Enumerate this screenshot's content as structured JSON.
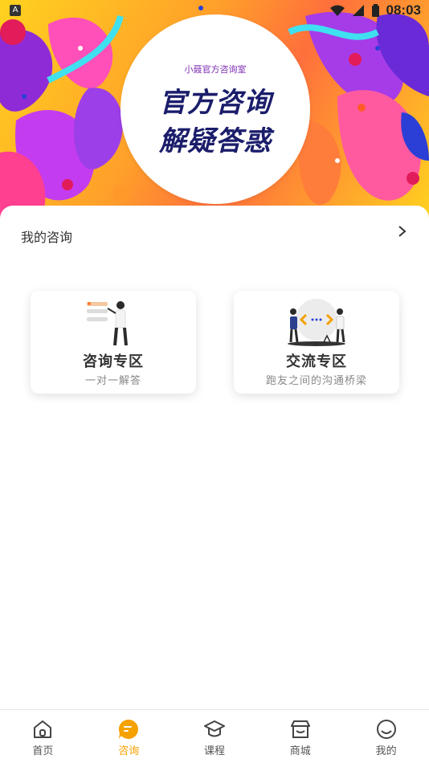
{
  "status_bar": {
    "time": "08:03",
    "indicator": "A"
  },
  "banner": {
    "room_name": "小聂官方咨询室",
    "slogan_line1": "官方咨询",
    "slogan_line2": "解疑答惑"
  },
  "my_consult": {
    "label": "我的咨询"
  },
  "cards": [
    {
      "title": "咨询专区",
      "subtitle": "一对一解答"
    },
    {
      "title": "交流专区",
      "subtitle": "跑友之间的沟通桥梁"
    }
  ],
  "nav": {
    "active_color": "#f5a100",
    "items": [
      {
        "label": "首页",
        "icon": "home-icon"
      },
      {
        "label": "咨询",
        "icon": "chat-icon"
      },
      {
        "label": "课程",
        "icon": "graduation-cap-icon"
      },
      {
        "label": "商城",
        "icon": "store-icon"
      },
      {
        "label": "我的",
        "icon": "smile-icon"
      }
    ]
  }
}
